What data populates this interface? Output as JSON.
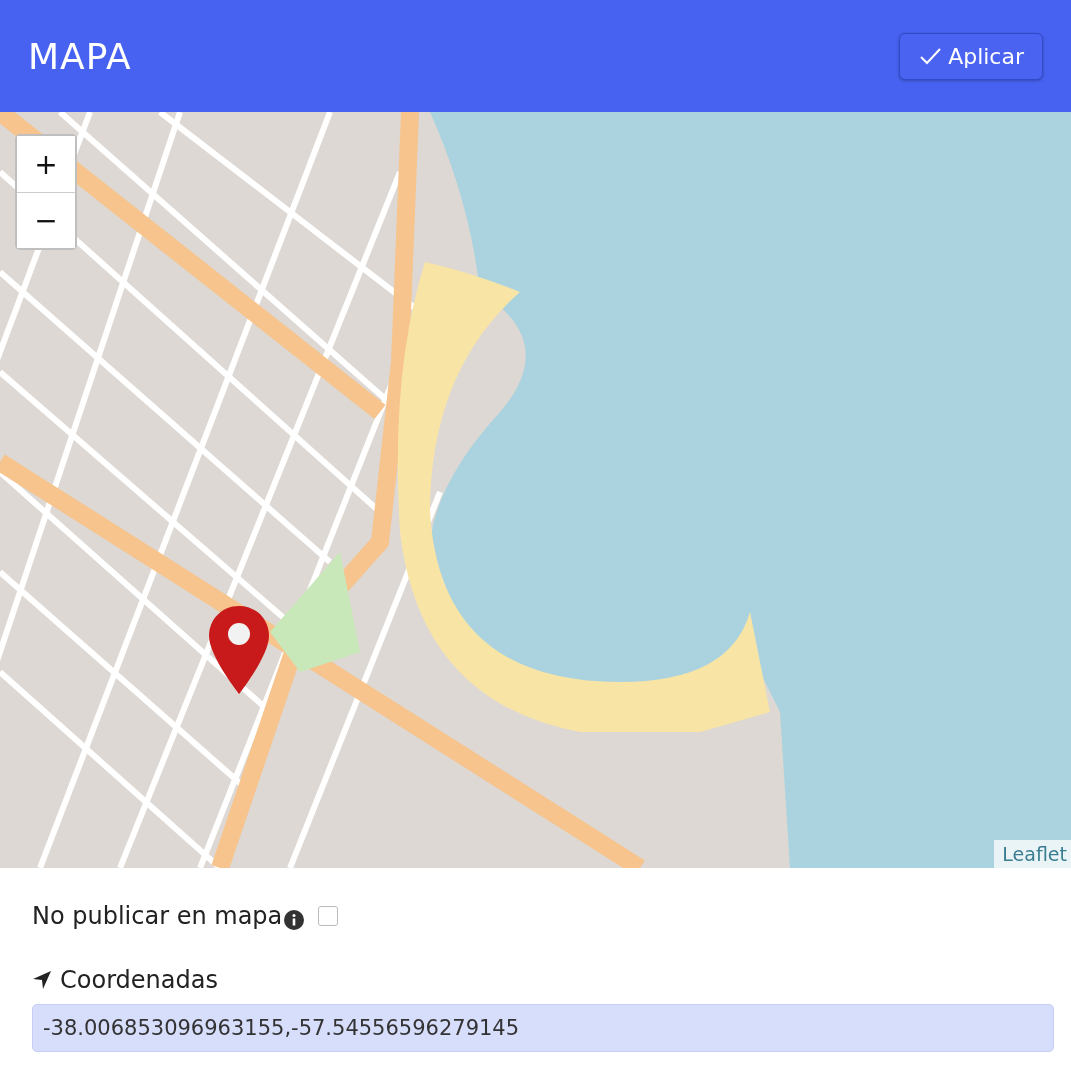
{
  "header": {
    "title": "MAPA",
    "apply_button": {
      "label": "Aplicar"
    }
  },
  "map": {
    "zoom_in": "+",
    "zoom_out": "−",
    "attribution": "Leaflet"
  },
  "no_publish": {
    "label": "No publicar en mapa",
    "checked": false
  },
  "coordinates": {
    "label": "Coordenadas",
    "value": "-38.006853096963155,-57.54556596279145"
  }
}
